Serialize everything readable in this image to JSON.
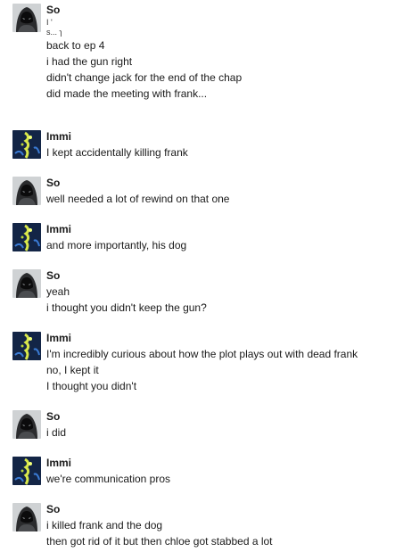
{
  "messages": [
    {
      "author": "So",
      "avatar_icon": "hooded-figure-icon",
      "garbled": [
        "I '",
        "s... ɿ"
      ],
      "lines": [
        "back to ep 4",
        "i had the gun right",
        "didn't change jack for the end of the chap",
        "did made the meeting with frank..."
      ]
    },
    {
      "author": "Immi",
      "avatar_icon": "glowing-figure-icon",
      "lines": [
        "I kept accidentally killing frank"
      ]
    },
    {
      "author": "So",
      "avatar_icon": "hooded-figure-icon",
      "lines": [
        "well needed a lot of rewind on that one"
      ]
    },
    {
      "author": "Immi",
      "avatar_icon": "glowing-figure-icon",
      "lines": [
        "and more importantly, his dog"
      ]
    },
    {
      "author": "So",
      "avatar_icon": "hooded-figure-icon",
      "lines": [
        "yeah",
        "i thought you didn't keep the gun?"
      ]
    },
    {
      "author": "Immi",
      "avatar_icon": "glowing-figure-icon",
      "lines": [
        "I'm incredibly curious about how the plot plays out with dead frank",
        "no, I kept it",
        "I thought you didn't"
      ]
    },
    {
      "author": "So",
      "avatar_icon": "hooded-figure-icon",
      "lines": [
        "i did"
      ]
    },
    {
      "author": "Immi",
      "avatar_icon": "glowing-figure-icon",
      "lines": [
        "we're communication pros"
      ]
    },
    {
      "author": "So",
      "avatar_icon": "hooded-figure-icon",
      "lines": [
        "i killed frank and the dog",
        "then got rid of it but then chloe got stabbed a lot"
      ]
    }
  ]
}
